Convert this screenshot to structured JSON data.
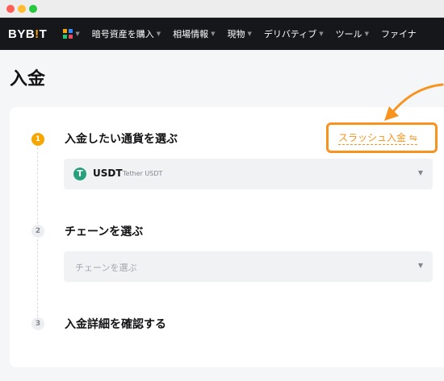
{
  "browser": {
    "window_dots": [
      "close",
      "minimize",
      "maximize"
    ]
  },
  "nav": {
    "logo": {
      "part1": "BYB",
      "bar": "!",
      "part2": "T"
    },
    "items": [
      "暗号資産を購入",
      "相場情報",
      "現物",
      "デリバティブ",
      "ツール",
      "ファイナ"
    ]
  },
  "page": {
    "title": "入金"
  },
  "slash": {
    "label": "スラッシュ入金 ⇋"
  },
  "steps": [
    {
      "number": "1",
      "title": "入金したい通貨を選ぶ",
      "active": true
    },
    {
      "number": "2",
      "title": "チェーンを選ぶ",
      "active": false
    },
    {
      "number": "3",
      "title": "入金詳細を確認する",
      "active": false
    }
  ],
  "currency_select": {
    "icon": "tether-icon",
    "icon_glyph": "T",
    "code": "USDT",
    "name": "Tether USDT"
  },
  "chain_select": {
    "placeholder": "チェーンを選ぶ"
  },
  "colors": {
    "accent": "#f7a600",
    "highlight": "#f7931e",
    "nav_bg": "#16171a",
    "tether": "#26a17b"
  }
}
